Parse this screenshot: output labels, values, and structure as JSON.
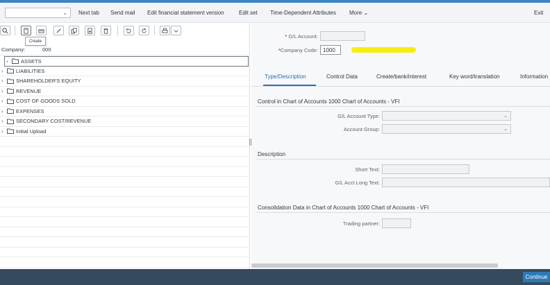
{
  "toolbar": {
    "dropdown_value": "",
    "buttons": [
      "Next tab",
      "Send mail",
      "Edit financial statement version",
      "Edit set",
      "Time-Dependent Attributes",
      "More"
    ],
    "exit_label": "Exit"
  },
  "left": {
    "icons": [
      "search-icon",
      "create-icon",
      "display-icon",
      "edit-icon",
      "copy-icon",
      "save-icon",
      "delete-icon",
      "undo-icon",
      "refresh-icon",
      "print-icon",
      "dropdown-icon"
    ],
    "tooltip": "Create",
    "tree_header": "Company:",
    "tree_header_tail": "000",
    "tree_items": [
      "ASSETS",
      "LIABILITIES",
      "SHAREHOLDER'S EQUITY",
      "REVENUE",
      "COST OF GOODS SOLD",
      "EXPENSES",
      "SECONDARY COST/REVENUE",
      "Initial Upload"
    ]
  },
  "right": {
    "gl_account_label": "G/L Account",
    "gl_account_value": "",
    "company_code_label": "Company Code",
    "company_code_value": "1000",
    "highlight_color": "#f4ee0a",
    "tabs": [
      "Type/Description",
      "Control Data",
      "Create/bank/interest",
      "Key word/translation",
      "Information"
    ],
    "active_tab": "Type/Description",
    "sections": {
      "control_title": "Control in Chart of Accounts 1000 Chart of Accounts - VFI",
      "account_type_label": "G/L Account Type:",
      "account_group_label": "Account Group:",
      "description_title": "Description",
      "short_text_label": "Short Text:",
      "long_text_label": "G/L Acct Long Text:",
      "consolidation_title": "Consolidation Data in Chart of Accounts 1000 Chart of Accounts - VFI",
      "trading_partner_label": "Trading partner:"
    }
  },
  "footer": {
    "continue_label": "Continue",
    "bar_color": "#354a5f",
    "accent_color": "#2a7ab6"
  }
}
